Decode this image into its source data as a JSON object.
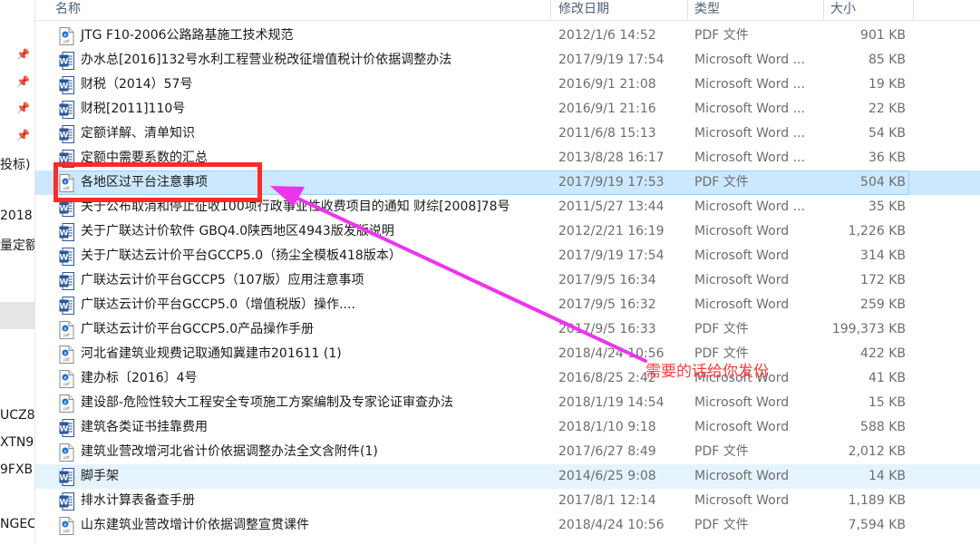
{
  "left_nav": {
    "fragments": [
      "投标)",
      "2018",
      "量定额",
      "UCZ8",
      "XTN9",
      "9FXB",
      "NGEC"
    ]
  },
  "columns": {
    "name": "名称",
    "modified": "修改日期",
    "type": "类型",
    "size": "大小"
  },
  "files": [
    {
      "name": "JTG F10-2006公路路基施工技术规范",
      "date": "2012/1/6 14:52",
      "type": "PDF 文件",
      "size": "901 KB",
      "icon": "pdf"
    },
    {
      "name": "办水总[2016]132号水利工程营业税改征增值税计价依据调整办法",
      "date": "2017/9/19 17:54",
      "type": "Microsoft Word ...",
      "size": "85 KB",
      "icon": "word"
    },
    {
      "name": "财税（2014）57号",
      "date": "2016/9/1 21:08",
      "type": "Microsoft Word ...",
      "size": "19 KB",
      "icon": "word"
    },
    {
      "name": "财税[2011]110号",
      "date": "2016/9/1 21:16",
      "type": "Microsoft Word ...",
      "size": "22 KB",
      "icon": "word"
    },
    {
      "name": "定额详解、清单知识",
      "date": "2011/6/8 15:13",
      "type": "Microsoft Word ...",
      "size": "54 KB",
      "icon": "word"
    },
    {
      "name": "定额中需要系数的汇总",
      "date": "2013/8/28 16:17",
      "type": "Microsoft Word ...",
      "size": "36 KB",
      "icon": "word"
    },
    {
      "name": "各地区过平台注意事项",
      "date": "2017/9/19 17:53",
      "type": "PDF 文件",
      "size": "504 KB",
      "icon": "pdf"
    },
    {
      "name": "关于公布取消和停止征收100项行政事业性收费项目的通知 财综[2008]78号",
      "date": "2011/5/27 13:44",
      "type": "Microsoft Word ...",
      "size": "35 KB",
      "icon": "word"
    },
    {
      "name": "关于广联达计价软件 GBQ4.0陕西地区4943版发版说明",
      "date": "2012/2/21 16:19",
      "type": "Microsoft Word",
      "size": "1,226 KB",
      "icon": "word"
    },
    {
      "name": "关于广联达云计价平台GCCP5.0（扬尘全模板418版本）",
      "date": "2017/9/19 17:54",
      "type": "Microsoft Word",
      "size": "314 KB",
      "icon": "word"
    },
    {
      "name": "广联达云计价平台GCCP5（107版）应用注意事项",
      "date": "2017/9/5 16:34",
      "type": "Microsoft Word",
      "size": "172 KB",
      "icon": "word"
    },
    {
      "name": "广联达云计价平台GCCP5.0（增值税版）操作....",
      "date": "2017/9/5 16:32",
      "type": "Microsoft Word",
      "size": "259 KB",
      "icon": "word"
    },
    {
      "name": "广联达云计价平台GCCP5.0产品操作手册",
      "date": "2017/9/5 16:33",
      "type": "PDF 文件",
      "size": "199,373 KB",
      "icon": "pdf"
    },
    {
      "name": "河北省建筑业规费记取通知冀建市201611 (1)",
      "date": "2018/4/24 10:56",
      "type": "PDF 文件",
      "size": "422 KB",
      "icon": "pdf"
    },
    {
      "name": "建办标〔2016〕4号",
      "date": "2016/8/25 2:42",
      "type": "Microsoft Word",
      "size": "41 KB",
      "icon": "pdf"
    },
    {
      "name": "建设部-危险性较大工程安全专项施工方案编制及专家论证审查办法",
      "date": "2018/1/19 14:54",
      "type": "Microsoft Word",
      "size": "15 KB",
      "icon": "pdf"
    },
    {
      "name": "建筑各类证书挂靠费用",
      "date": "2018/1/10 9:18",
      "type": "Microsoft Word",
      "size": "588 KB",
      "icon": "word"
    },
    {
      "name": "建筑业营改增河北省计价依据调整办法全文含附件(1)",
      "date": "2017/6/27 8:49",
      "type": "PDF 文件",
      "size": "2,012 KB",
      "icon": "pdf"
    },
    {
      "name": "脚手架",
      "date": "2014/6/25 9:08",
      "type": "Microsoft Word",
      "size": "14 KB",
      "icon": "word"
    },
    {
      "name": "排水计算表备查手册",
      "date": "2017/8/1 12:14",
      "type": "Microsoft Word",
      "size": "1,189 KB",
      "icon": "word"
    },
    {
      "name": "山东建筑业营改增计价依据调整宣贯课件",
      "date": "2018/4/24 10:56",
      "type": "PDF 文件",
      "size": "7,594 KB",
      "icon": "pdf"
    }
  ],
  "annotation": {
    "text": "需要的话给你发份",
    "color": "#ff3a3a"
  },
  "colors": {
    "selected_row": "#cce8ff",
    "hover_row": "#e5f3ff",
    "highlight_box": "#ff2a2a",
    "arrow": "#ee33ee"
  }
}
